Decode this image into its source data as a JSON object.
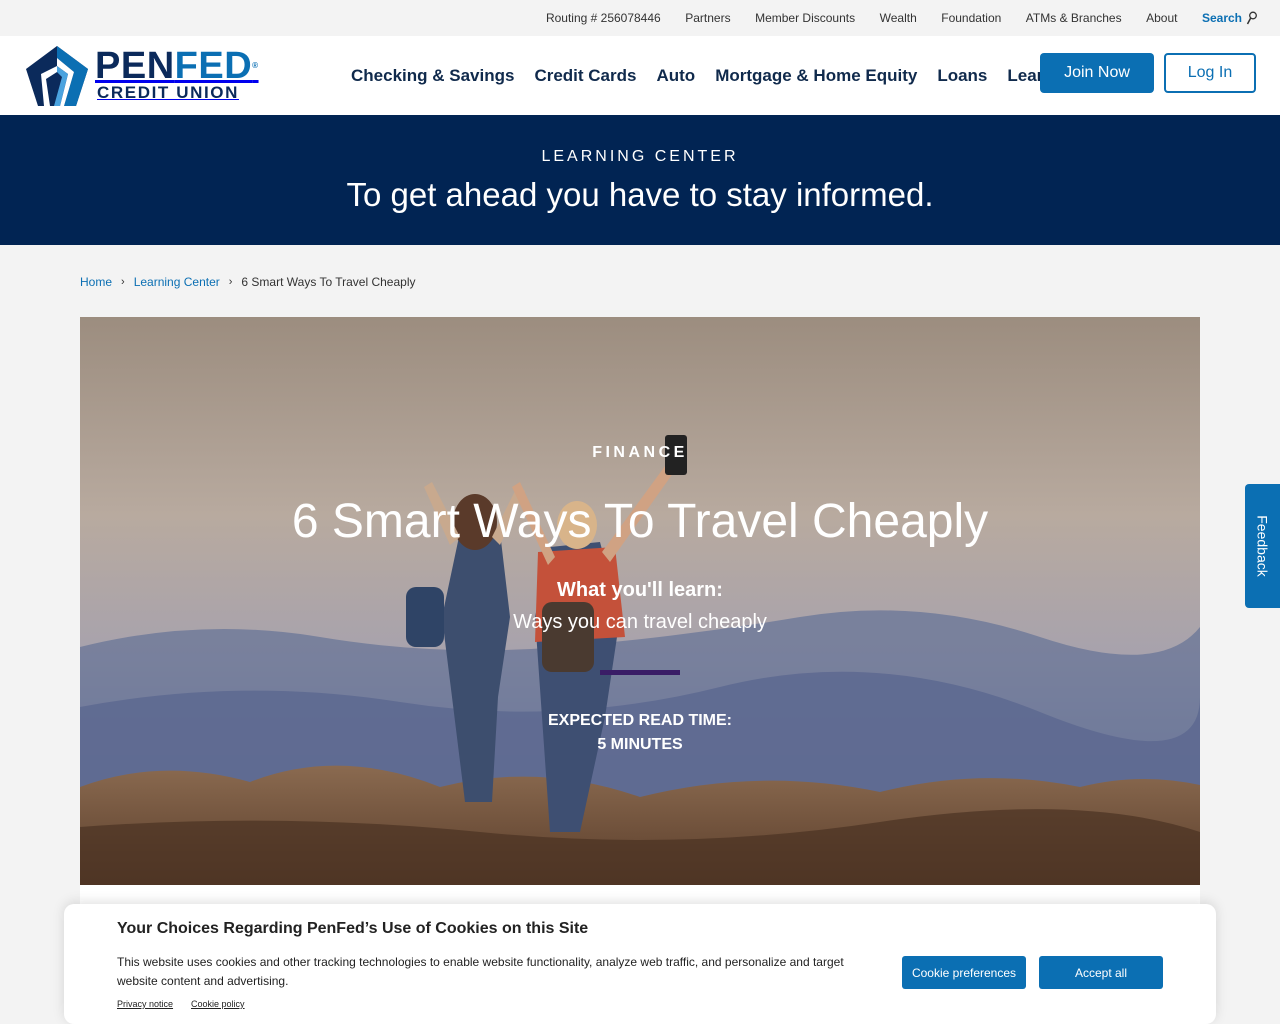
{
  "utility_nav": {
    "routing": "Routing # 256078446",
    "partners": "Partners",
    "member_discounts": "Member Discounts",
    "wealth": "Wealth",
    "foundation": "Foundation",
    "atms": "ATMs & Branches",
    "about": "About",
    "search": "Search"
  },
  "logo": {
    "pen": "PEN",
    "fed": "FED",
    "reg": "®",
    "sub": "CREDIT UNION"
  },
  "main_nav": {
    "checking": "Checking & Savings",
    "credit_cards": "Credit Cards",
    "auto": "Auto",
    "mortgage": "Mortgage & Home Equity",
    "loans": "Loans",
    "learn": "Learn"
  },
  "buttons": {
    "join": "Join Now",
    "login": "Log In"
  },
  "banner": {
    "eyebrow": "LEARNING CENTER",
    "headline": "To get ahead you have to stay informed."
  },
  "breadcrumb": {
    "home": "Home",
    "learning_center": "Learning Center",
    "current": "6 Smart Ways To Travel Cheaply",
    "sep": "›"
  },
  "hero": {
    "category": "FINANCE",
    "title": "6 Smart Ways To Travel Cheaply",
    "learn_heading": "What you'll learn:",
    "learn_text": "Ways you can travel cheaply",
    "read_heading": "EXPECTED READ TIME:",
    "read_value": "5 MINUTES"
  },
  "feedback": "Feedback",
  "cookie": {
    "title": "Your Choices Regarding PenFed’s Use of Cookies on this Site",
    "body": "This website uses cookies and other tracking technologies to enable website functionality, analyze web traffic, and personalize and target website content and advertising.",
    "privacy": "Privacy notice",
    "policy": "Cookie policy",
    "preferences": "Cookie preferences",
    "accept": "Accept all"
  },
  "colors": {
    "brand_navy": "#012453",
    "brand_blue": "#0b6fb3",
    "accent_purple": "#3a1d66"
  }
}
